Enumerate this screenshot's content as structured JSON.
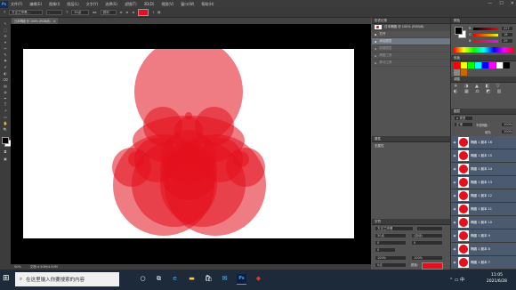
{
  "app": {
    "logo": "Ps",
    "menu": [
      "文件(F)",
      "编辑(E)",
      "图像(I)",
      "图层(L)",
      "文字(Y)",
      "选择(S)",
      "滤镜(T)",
      "3D(D)",
      "视图(V)",
      "窗口(W)",
      "帮助(H)"
    ],
    "window_controls": [
      "—",
      "☐",
      "✕"
    ]
  },
  "options_bar": {
    "font_family": "方正兰亭黑...",
    "font_style": "-",
    "font_size": "30点",
    "aa": "aa",
    "aa_mode": "锐利",
    "text_color": "#e3101d"
  },
  "document": {
    "tab_title": "日本椭圆 @ 100% (RGB/8)",
    "zoom": "50%",
    "doc_size": "文档:4.50M/4.50M"
  },
  "toolbar": {
    "tools": [
      "↖",
      "⬚",
      "✣",
      "⌖",
      "✂",
      "✎",
      "⚑",
      "✐",
      "◐",
      "⌫",
      "▤",
      "◍",
      "✒",
      "T",
      "↗",
      "▭",
      "✋",
      "🔍"
    ],
    "fg_color": "#000000",
    "bg_color": "#ffffff"
  },
  "history_panel": {
    "title": "历史记录",
    "items": [
      {
        "label": "打开",
        "state": "sel"
      },
      {
        "label": "添加图层",
        "state": "normal"
      },
      {
        "label": "新建图层",
        "state": "dim"
      },
      {
        "label": "椭圆工具",
        "state": "dim"
      },
      {
        "label": "移动工具",
        "state": "dim"
      }
    ]
  },
  "props_panel": {
    "title": "属性",
    "subtitle": "无属性"
  },
  "char_panel": {
    "title": "字符",
    "font_family": "方正兰亭黑",
    "font_style": "-",
    "size": "30点",
    "leading": "(自动)",
    "tracking": "0",
    "kerning": "0",
    "scale_v": "100%",
    "scale_h": "100%",
    "baseline": "0点",
    "color_label": "颜色:",
    "color": "#e3101d",
    "language": "美国英语",
    "aa_mode": "锐利"
  },
  "color_panel": {
    "title": "颜色",
    "r_label": "R",
    "g_label": "G",
    "b_label": "B",
    "r": "227",
    "g": "16",
    "b": "29"
  },
  "swatch_panel": {
    "title": "色板",
    "adjust_title": "调整",
    "swatches": [
      "#ff0000",
      "#ffff00",
      "#00ff00",
      "#00ffff",
      "#0000ff",
      "#ff00ff",
      "#ffffff",
      "#000000",
      "#888888",
      "#cc6600"
    ]
  },
  "layers_panel": {
    "title": "图层",
    "mode": "正常",
    "opacity_label": "不透明度:",
    "opacity": "100%",
    "fill_label": "填充:",
    "fill": "100%",
    "layers": [
      "椭圆 1 副本 16",
      "椭圆 1 副本 15",
      "椭圆 1 副本 14",
      "椭圆 1 副本 13",
      "椭圆 1 副本 12",
      "椭圆 1 副本 11",
      "椭圆 1 副本 10",
      "椭圆 1 副本 9",
      "椭圆 1 副本 8",
      "椭圆 1 副本 7",
      "椭圆 1 副本 6"
    ]
  },
  "taskbar": {
    "search_placeholder": "在这里输入你要搜索的内容",
    "time": "11:05",
    "date": "2021/6/28"
  },
  "canvas_shapes": {
    "fill": "#e3101d",
    "fill_opacity": 0.55
  }
}
